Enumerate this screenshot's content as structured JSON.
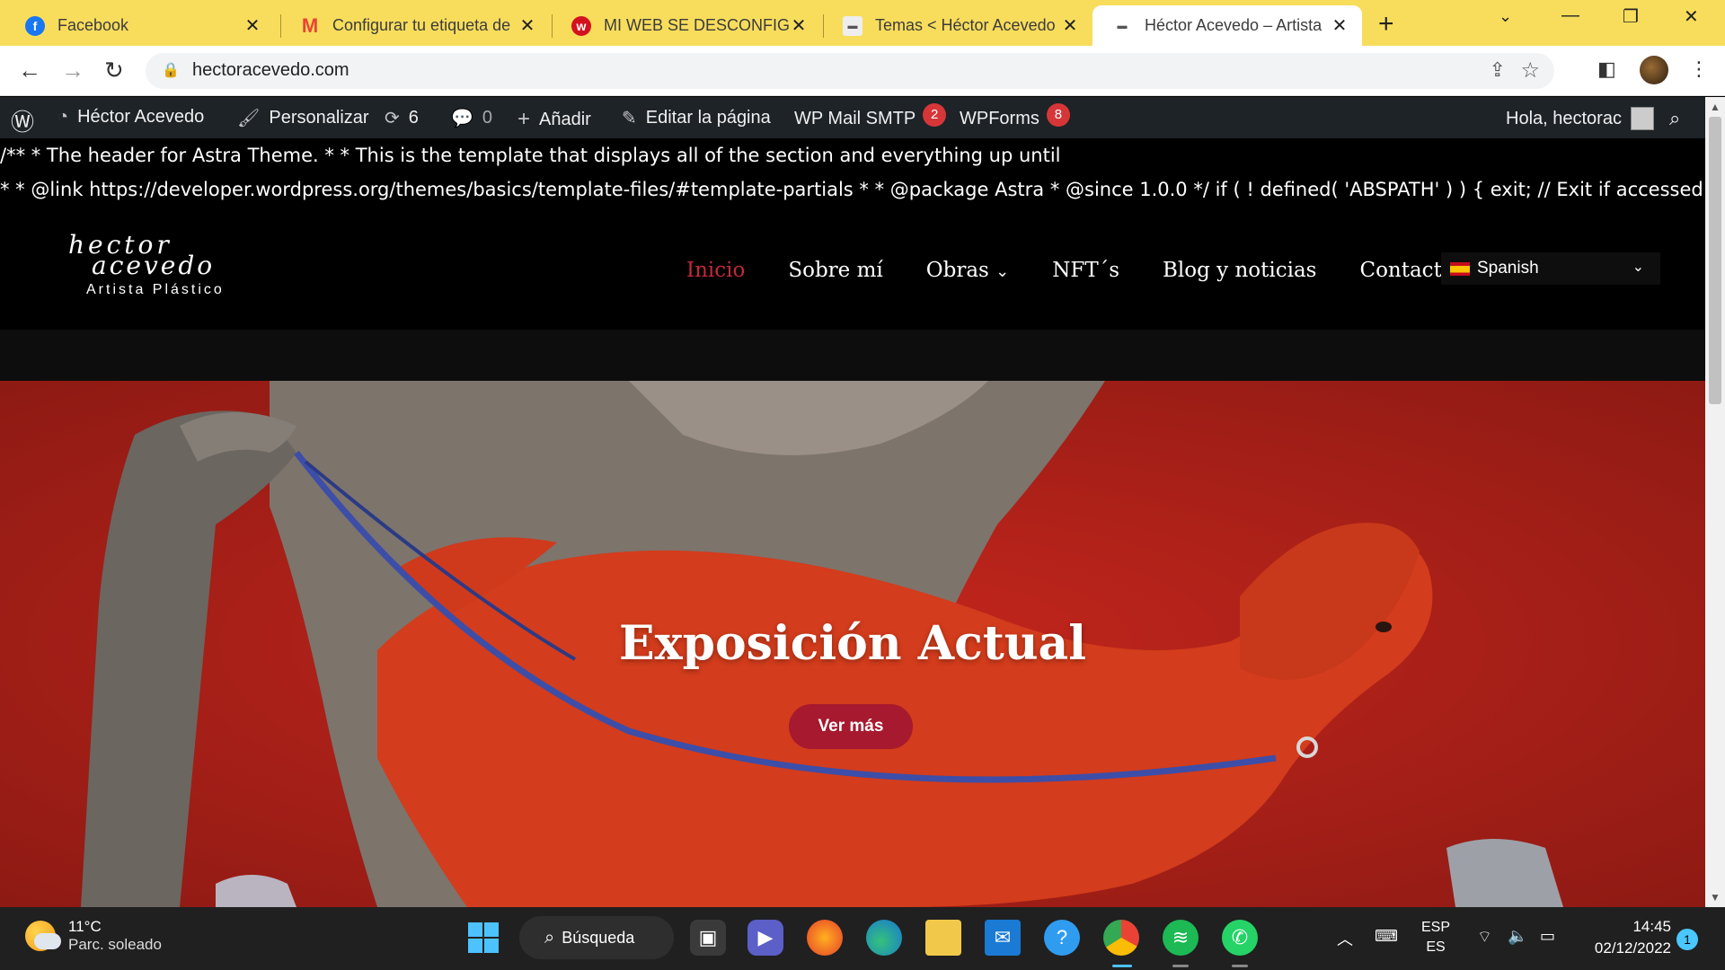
{
  "browser": {
    "tabs": [
      {
        "title": "Facebook",
        "icon": "facebook-icon",
        "color": "#1877f2"
      },
      {
        "title": "Configurar tu etiqueta de",
        "icon": "gmail-icon",
        "color": "#ea4335"
      },
      {
        "title": "MI WEB SE DESCONFIGURÓ",
        "icon": "webempresa-icon",
        "color": "#d4121f"
      },
      {
        "title": "Temas < Héctor Acevedo",
        "icon": "site-icon",
        "color": "#555555"
      },
      {
        "title": "Héctor Acevedo – Artista",
        "icon": "site-icon",
        "color": "#555555"
      }
    ],
    "url": "hectoracevedo.com",
    "tab_bg": "#f8dd5c"
  },
  "wpbar": {
    "site_name": "Héctor Acevedo",
    "customize": "Personalizar",
    "updates": "6",
    "comments": "0",
    "add_new": "Añadir",
    "edit_page": "Editar la página",
    "smtp": "WP Mail SMTP",
    "smtp_count": "2",
    "wpforms": "WPForms",
    "wpforms_count": "8",
    "greeting": "Hola, hectorac"
  },
  "php_leak": {
    "line1": "/** * The header for Astra Theme. * * This is the template that displays all of the section and everything up until",
    "line2": "* * @link https://developer.wordpress.org/themes/basics/template-files/#template-partials * * @package Astra * @since 1.0.0 */ if ( ! defined( 'ABSPATH' ) ) { exit; // Exit if accessed directly. } ?>"
  },
  "site": {
    "logo_line1": "hector",
    "logo_line2": "acevedo",
    "logo_tagline": "Artista Plástico",
    "menu": [
      "Inicio",
      "Sobre mí",
      "Obras",
      "NFT´s",
      "Blog y noticias",
      "Contacto"
    ],
    "language": "Spanish",
    "accent": "#c4283a"
  },
  "hero": {
    "title": "Exposición Actual",
    "button": "Ver más"
  },
  "taskbar": {
    "temperature": "11°C",
    "condition": "Parc. soleado",
    "search": "Búsqueda",
    "lang_top": "ESP",
    "lang_bottom": "ES",
    "time": "14:45",
    "date": "02/12/2022",
    "notifications": "1"
  }
}
